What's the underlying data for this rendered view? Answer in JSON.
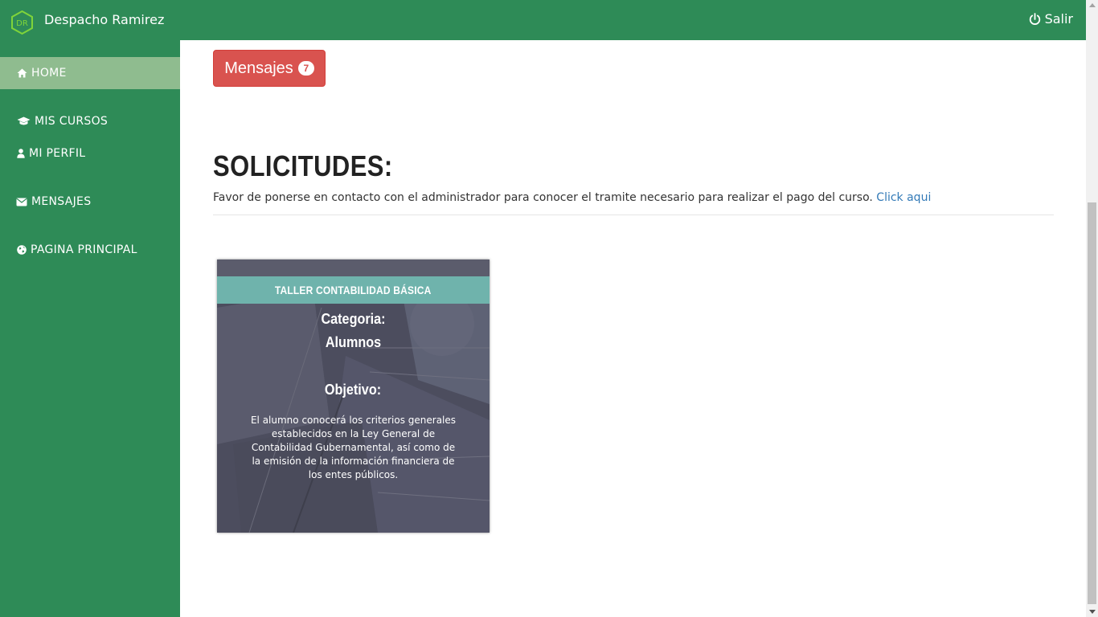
{
  "app": {
    "brand_name": "Despacho Ramirez",
    "logo_initials": "DR",
    "logout_label": "Salir"
  },
  "sidebar": {
    "items": [
      {
        "label": "HOME",
        "icon": "home-icon",
        "active": true
      },
      {
        "label": "MIS CURSOS",
        "icon": "graduation-cap-icon",
        "active": false
      },
      {
        "label": "MI PERFIL",
        "icon": "user-icon",
        "active": false
      },
      {
        "label": "MENSAJES",
        "icon": "envelope-icon",
        "active": false
      },
      {
        "label": "PAGINA PRINCIPAL",
        "icon": "globe-icon",
        "active": false
      }
    ]
  },
  "main": {
    "messages_button": {
      "label": "Mensajes",
      "badge_count": "7"
    },
    "section_title": "SOLICITUDES:",
    "info_text": "Favor de ponerse en contacto con el administrador para conocer el tramite necesario para realizar el pago del curso.",
    "info_link": "Click aqui",
    "course_card": {
      "title": "TALLER CONTABILIDAD BÁSICA",
      "category_label": "Categoria:",
      "category_value": "Alumnos",
      "objective_label": "Objetivo:",
      "objective_text": "El alumno conocerá los criterios generales establecidos en la Ley General de Contabilidad Gubernamental, así como de la emisión de la información financiera de los entes públicos."
    }
  },
  "colors": {
    "primary_green": "#2e8b57",
    "active_item": "#8fbc8f",
    "danger": "#d9534f",
    "card_header": "#6fb3ac",
    "link": "#337ab7"
  }
}
